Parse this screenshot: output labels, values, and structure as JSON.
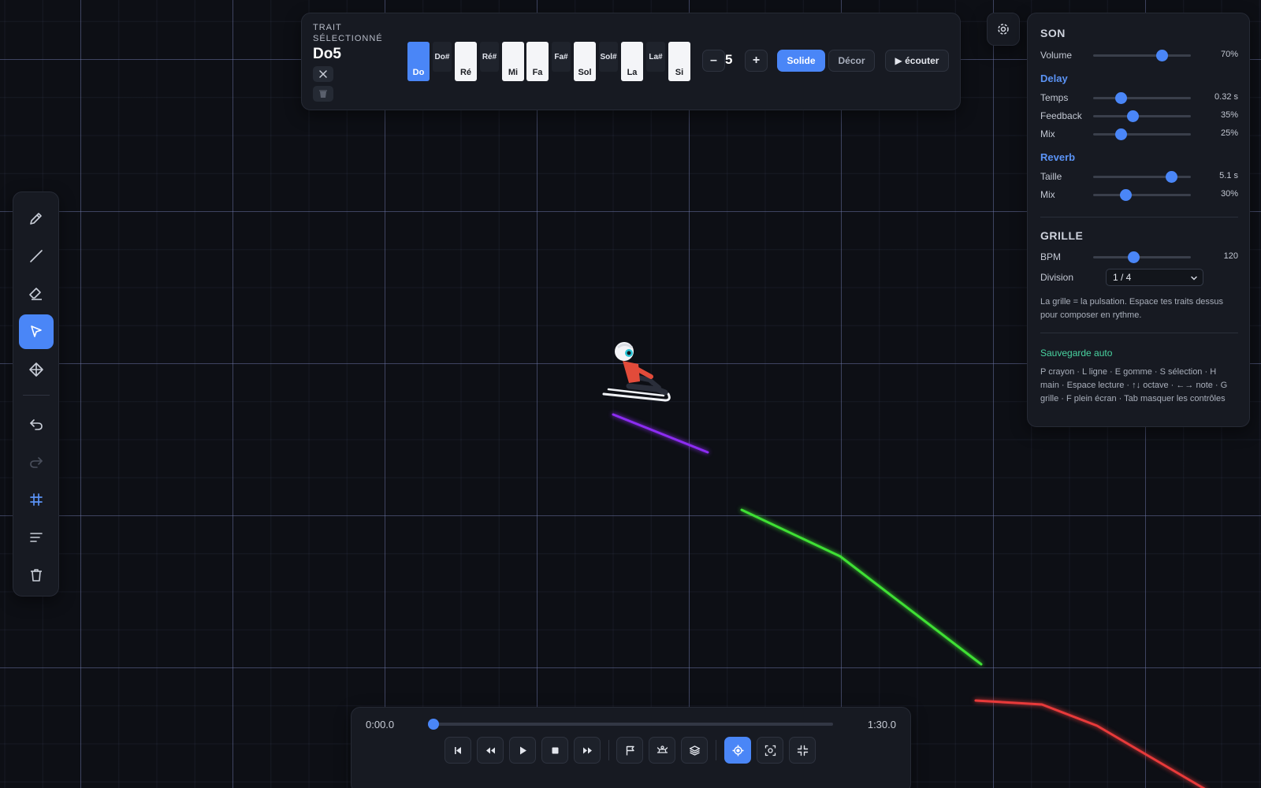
{
  "canvas": {
    "grid_color": "#3e4566",
    "stroke_colors": {
      "purple": "#8c2cf2",
      "green": "#3fe034",
      "red": "#e83a3a"
    },
    "rider": "sled-rider"
  },
  "toolbar": {
    "tools": [
      "pencil",
      "line",
      "eraser",
      "select",
      "pan",
      "undo",
      "redo",
      "grid",
      "align",
      "trash"
    ],
    "active": "select"
  },
  "note_panel": {
    "label": "TRAIT SÉLECTIONNÉ",
    "selected_note": "Do5",
    "keys": [
      {
        "label": "Do",
        "type": "white",
        "selected": true
      },
      {
        "label": "Do#",
        "type": "black",
        "selected": false
      },
      {
        "label": "Ré",
        "type": "white",
        "selected": false
      },
      {
        "label": "Ré#",
        "type": "black",
        "selected": false
      },
      {
        "label": "Mi",
        "type": "white",
        "selected": false
      },
      {
        "label": "Fa",
        "type": "white",
        "selected": false
      },
      {
        "label": "Fa#",
        "type": "black",
        "selected": false
      },
      {
        "label": "Sol",
        "type": "white",
        "selected": false
      },
      {
        "label": "Sol#",
        "type": "black",
        "selected": false
      },
      {
        "label": "La",
        "type": "white",
        "selected": false
      },
      {
        "label": "La#",
        "type": "black",
        "selected": false
      },
      {
        "label": "Si",
        "type": "white",
        "selected": false
      }
    ],
    "octave_minus": "–",
    "octave": "5",
    "octave_plus": "+",
    "solid_label": "Solide",
    "decor_label": "Décor",
    "listen_label": "▶ écouter"
  },
  "sound_panel": {
    "title": "SON",
    "volume": {
      "label": "Volume",
      "value": "70%",
      "level": 0.7
    },
    "delay_title": "Delay",
    "delay": [
      {
        "label": "Temps",
        "value": "0.32 s",
        "level": 0.28
      },
      {
        "label": "Feedback",
        "value": "35%",
        "level": 0.4
      },
      {
        "label": "Mix",
        "value": "25%",
        "level": 0.28
      }
    ],
    "reverb_title": "Reverb",
    "reverb": [
      {
        "label": "Taille",
        "value": "5.1 s",
        "level": 0.8
      },
      {
        "label": "Mix",
        "value": "30%",
        "level": 0.33
      }
    ],
    "grid_title": "GRILLE",
    "bpm": {
      "label": "BPM",
      "value": "120",
      "level": 0.41
    },
    "division_label": "Division",
    "division_value": "1 / 4",
    "grid_hint": "La grille = la pulsation. Espace tes traits dessus pour composer en rythme.",
    "autosave": "Sauvegarde auto",
    "shortcuts": "P crayon · L ligne · E gomme · S sélection · H main · Espace lecture · ↑↓ octave · ←→ note · G grille · F plein écran · Tab masquer les contrôles"
  },
  "transport": {
    "current_time": "0:00.0",
    "total_time": "1:30.0",
    "progress": 0.0,
    "buttons": [
      "rewind-start",
      "rewind",
      "play",
      "stop",
      "fast-forward",
      "flag",
      "sled",
      "layers",
      "target",
      "focus",
      "collapse"
    ],
    "active": "target"
  }
}
